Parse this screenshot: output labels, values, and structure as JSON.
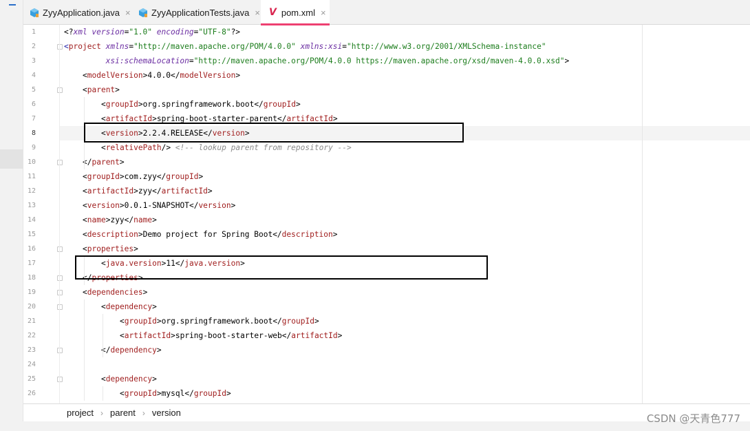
{
  "tabs": [
    {
      "label": "ZyyApplication.java",
      "icon": "java-class-icon",
      "active": false,
      "close": "×"
    },
    {
      "label": "ZyyApplicationTests.java",
      "icon": "java-class-icon",
      "active": false,
      "close": "×"
    },
    {
      "label": "pom.xml",
      "icon": "maven-icon",
      "icon_glyph": "V",
      "active": true,
      "close": "×"
    }
  ],
  "editor": {
    "current_line": 8,
    "lines": [
      {
        "n": 1,
        "indent": 0,
        "tokens": [
          {
            "t": "t",
            "s": "<?"
          },
          {
            "t": "attr",
            "s": "xml version"
          },
          {
            "t": "t",
            "s": "="
          },
          {
            "t": "val",
            "s": "\"1.0\""
          },
          {
            "t": "t",
            "s": " "
          },
          {
            "t": "attr",
            "s": "encoding"
          },
          {
            "t": "t",
            "s": "="
          },
          {
            "t": "val",
            "s": "\"UTF-8\""
          },
          {
            "t": "t",
            "s": "?>"
          }
        ]
      },
      {
        "n": 2,
        "indent": 0,
        "tokens": [
          {
            "t": "tag",
            "s": "<"
          },
          {
            "t": "tg",
            "s": "project"
          },
          {
            "t": "t",
            "s": " "
          },
          {
            "t": "attr",
            "s": "xmlns"
          },
          {
            "t": "t",
            "s": "="
          },
          {
            "t": "val",
            "s": "\"http://maven.apache.org/POM/4.0.0\""
          },
          {
            "t": "t",
            "s": " "
          },
          {
            "t": "attr",
            "s": "xmlns:xsi"
          },
          {
            "t": "t",
            "s": "="
          },
          {
            "t": "val",
            "s": "\"http://www.w3.org/2001/XMLSchema-instance\""
          }
        ]
      },
      {
        "n": 3,
        "indent": 0,
        "tokens": [
          {
            "t": "t",
            "s": "         "
          },
          {
            "t": "attr",
            "s": "xsi:schemaLocation"
          },
          {
            "t": "t",
            "s": "="
          },
          {
            "t": "val",
            "s": "\"http://maven.apache.org/POM/4.0.0 https://maven.apache.org/xsd/maven-4.0.0.xsd\""
          },
          {
            "t": "t",
            "s": ">"
          }
        ]
      },
      {
        "n": 4,
        "indent": 1,
        "tokens": [
          {
            "t": "t",
            "s": "<"
          },
          {
            "t": "tg",
            "s": "modelVersion"
          },
          {
            "t": "t",
            "s": ">"
          },
          {
            "t": "txt",
            "s": "4.0.0"
          },
          {
            "t": "t",
            "s": "</"
          },
          {
            "t": "tg",
            "s": "modelVersion"
          },
          {
            "t": "t",
            "s": ">"
          }
        ]
      },
      {
        "n": 5,
        "indent": 1,
        "tokens": [
          {
            "t": "t",
            "s": "<"
          },
          {
            "t": "tg",
            "s": "parent"
          },
          {
            "t": "t",
            "s": ">"
          }
        ]
      },
      {
        "n": 6,
        "indent": 2,
        "tokens": [
          {
            "t": "t",
            "s": "<"
          },
          {
            "t": "tg",
            "s": "groupId"
          },
          {
            "t": "t",
            "s": ">"
          },
          {
            "t": "txt",
            "s": "org.springframework.boot"
          },
          {
            "t": "t",
            "s": "</"
          },
          {
            "t": "tg",
            "s": "groupId"
          },
          {
            "t": "t",
            "s": ">"
          }
        ]
      },
      {
        "n": 7,
        "indent": 2,
        "tokens": [
          {
            "t": "t",
            "s": "<"
          },
          {
            "t": "tg",
            "s": "artifactId"
          },
          {
            "t": "t",
            "s": ">"
          },
          {
            "t": "txt",
            "s": "spring-boot-starter-parent"
          },
          {
            "t": "t",
            "s": "</"
          },
          {
            "t": "tg",
            "s": "artifactId"
          },
          {
            "t": "t",
            "s": ">"
          }
        ]
      },
      {
        "n": 8,
        "indent": 2,
        "tokens": [
          {
            "t": "t",
            "s": "<"
          },
          {
            "t": "tg",
            "s": "version"
          },
          {
            "t": "t",
            "s": ">"
          },
          {
            "t": "txt",
            "s": "2.2.4.RELEASE"
          },
          {
            "t": "t",
            "s": "</"
          },
          {
            "t": "tg",
            "s": "version"
          },
          {
            "t": "t",
            "s": ">"
          }
        ]
      },
      {
        "n": 9,
        "indent": 2,
        "tokens": [
          {
            "t": "t",
            "s": "<"
          },
          {
            "t": "tg",
            "s": "relativePath"
          },
          {
            "t": "t",
            "s": "/> "
          },
          {
            "t": "cmt",
            "s": "<!-- lookup parent from repository -->"
          }
        ]
      },
      {
        "n": 10,
        "indent": 1,
        "tokens": [
          {
            "t": "t",
            "s": "</"
          },
          {
            "t": "tg",
            "s": "parent"
          },
          {
            "t": "t",
            "s": ">"
          }
        ]
      },
      {
        "n": 11,
        "indent": 1,
        "tokens": [
          {
            "t": "t",
            "s": "<"
          },
          {
            "t": "tg",
            "s": "groupId"
          },
          {
            "t": "t",
            "s": ">"
          },
          {
            "t": "txt",
            "s": "com.zyy"
          },
          {
            "t": "t",
            "s": "</"
          },
          {
            "t": "tg",
            "s": "groupId"
          },
          {
            "t": "t",
            "s": ">"
          }
        ]
      },
      {
        "n": 12,
        "indent": 1,
        "tokens": [
          {
            "t": "t",
            "s": "<"
          },
          {
            "t": "tg",
            "s": "artifactId"
          },
          {
            "t": "t",
            "s": ">"
          },
          {
            "t": "txt",
            "s": "zyy"
          },
          {
            "t": "t",
            "s": "</"
          },
          {
            "t": "tg",
            "s": "artifactId"
          },
          {
            "t": "t",
            "s": ">"
          }
        ]
      },
      {
        "n": 13,
        "indent": 1,
        "tokens": [
          {
            "t": "t",
            "s": "<"
          },
          {
            "t": "tg",
            "s": "version"
          },
          {
            "t": "t",
            "s": ">"
          },
          {
            "t": "txt",
            "s": "0.0.1-SNAPSHOT"
          },
          {
            "t": "t",
            "s": "</"
          },
          {
            "t": "tg",
            "s": "version"
          },
          {
            "t": "t",
            "s": ">"
          }
        ]
      },
      {
        "n": 14,
        "indent": 1,
        "tokens": [
          {
            "t": "t",
            "s": "<"
          },
          {
            "t": "tg",
            "s": "name"
          },
          {
            "t": "t",
            "s": ">"
          },
          {
            "t": "txt",
            "s": "zyy"
          },
          {
            "t": "t",
            "s": "</"
          },
          {
            "t": "tg",
            "s": "name"
          },
          {
            "t": "t",
            "s": ">"
          }
        ]
      },
      {
        "n": 15,
        "indent": 1,
        "tokens": [
          {
            "t": "t",
            "s": "<"
          },
          {
            "t": "tg",
            "s": "description"
          },
          {
            "t": "t",
            "s": ">"
          },
          {
            "t": "txt",
            "s": "Demo project for Spring Boot"
          },
          {
            "t": "t",
            "s": "</"
          },
          {
            "t": "tg",
            "s": "description"
          },
          {
            "t": "t",
            "s": ">"
          }
        ]
      },
      {
        "n": 16,
        "indent": 1,
        "tokens": [
          {
            "t": "t",
            "s": "<"
          },
          {
            "t": "tg",
            "s": "properties"
          },
          {
            "t": "t",
            "s": ">"
          }
        ]
      },
      {
        "n": 17,
        "indent": 2,
        "tokens": [
          {
            "t": "t",
            "s": "<"
          },
          {
            "t": "tg",
            "s": "java.version"
          },
          {
            "t": "t",
            "s": ">"
          },
          {
            "t": "txt",
            "s": "11"
          },
          {
            "t": "t",
            "s": "</"
          },
          {
            "t": "tg",
            "s": "java.version"
          },
          {
            "t": "t",
            "s": ">"
          }
        ]
      },
      {
        "n": 18,
        "indent": 1,
        "tokens": [
          {
            "t": "t",
            "s": "</"
          },
          {
            "t": "tg",
            "s": "properties"
          },
          {
            "t": "t",
            "s": ">"
          }
        ]
      },
      {
        "n": 19,
        "indent": 1,
        "tokens": [
          {
            "t": "t",
            "s": "<"
          },
          {
            "t": "tg",
            "s": "dependencies"
          },
          {
            "t": "t",
            "s": ">"
          }
        ]
      },
      {
        "n": 20,
        "indent": 2,
        "tokens": [
          {
            "t": "t",
            "s": "<"
          },
          {
            "t": "tg",
            "s": "dependency"
          },
          {
            "t": "t",
            "s": ">"
          }
        ]
      },
      {
        "n": 21,
        "indent": 3,
        "tokens": [
          {
            "t": "t",
            "s": "<"
          },
          {
            "t": "tg",
            "s": "groupId"
          },
          {
            "t": "t",
            "s": ">"
          },
          {
            "t": "txt",
            "s": "org.springframework.boot"
          },
          {
            "t": "t",
            "s": "</"
          },
          {
            "t": "tg",
            "s": "groupId"
          },
          {
            "t": "t",
            "s": ">"
          }
        ]
      },
      {
        "n": 22,
        "indent": 3,
        "tokens": [
          {
            "t": "t",
            "s": "<"
          },
          {
            "t": "tg",
            "s": "artifactId"
          },
          {
            "t": "t",
            "s": ">"
          },
          {
            "t": "txt",
            "s": "spring-boot-starter-web"
          },
          {
            "t": "t",
            "s": "</"
          },
          {
            "t": "tg",
            "s": "artifactId"
          },
          {
            "t": "t",
            "s": ">"
          }
        ]
      },
      {
        "n": 23,
        "indent": 2,
        "tokens": [
          {
            "t": "t",
            "s": "</"
          },
          {
            "t": "tg",
            "s": "dependency"
          },
          {
            "t": "t",
            "s": ">"
          }
        ]
      },
      {
        "n": 24,
        "indent": 0,
        "tokens": []
      },
      {
        "n": 25,
        "indent": 2,
        "tokens": [
          {
            "t": "t",
            "s": "<"
          },
          {
            "t": "tg",
            "s": "dependency"
          },
          {
            "t": "t",
            "s": ">"
          }
        ]
      },
      {
        "n": 26,
        "indent": 3,
        "tokens": [
          {
            "t": "t",
            "s": "<"
          },
          {
            "t": "tg",
            "s": "groupId"
          },
          {
            "t": "t",
            "s": ">"
          },
          {
            "t": "txt",
            "s": "mysql"
          },
          {
            "t": "t",
            "s": "</"
          },
          {
            "t": "tg",
            "s": "groupId"
          },
          {
            "t": "t",
            "s": ">"
          }
        ]
      }
    ]
  },
  "breadcrumb": [
    "project",
    "parent",
    "version"
  ],
  "breadcrumb_separator": "›",
  "watermark": "CSDN @天青色777",
  "colors": {
    "tag_name": "#a01e1e",
    "attribute": "#6b2ea2",
    "string": "#1c7d1c",
    "comment": "#8c8c8c",
    "active_tab_underline": "#ee4071",
    "current_line_bg": "#f4f4f4"
  }
}
